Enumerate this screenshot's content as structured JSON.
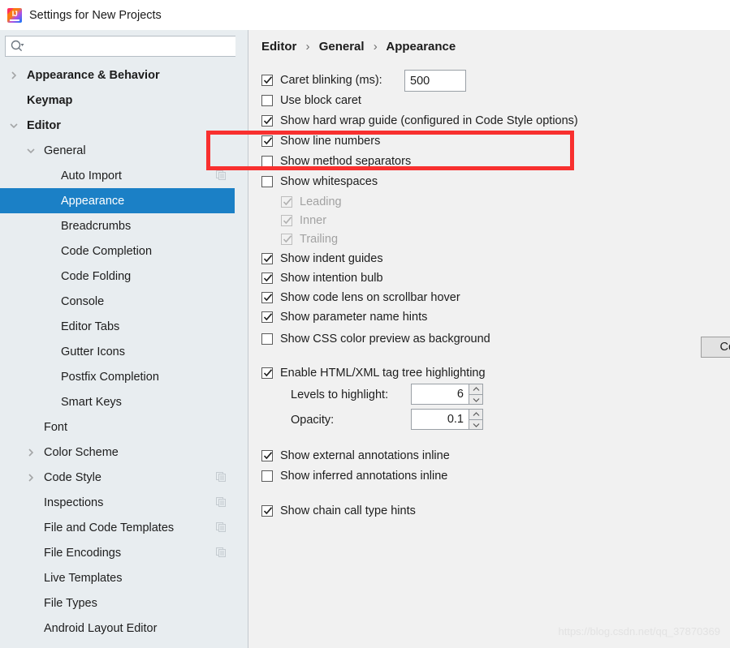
{
  "window": {
    "title": "Settings for New Projects",
    "app_icon": "intellij-idea-icon",
    "icon_text": "IJ"
  },
  "colors": {
    "selection_blue": "#1b80c6",
    "highlight_red": "#f8302f",
    "left_panel_bg": "#e8edf0",
    "right_panel_bg": "#f1f1f1",
    "scrollbar_thumb": "#c8ced4"
  },
  "search": {
    "value": "",
    "placeholder": "",
    "icon": "search-icon"
  },
  "sidebar": {
    "items": [
      {
        "label": "Appearance & Behavior",
        "level": 0,
        "arrow": "collapsed",
        "bold": true,
        "selected": false,
        "copy_icon": false
      },
      {
        "label": "Keymap",
        "level": 0,
        "arrow": "none",
        "bold": true,
        "selected": false,
        "copy_icon": false
      },
      {
        "label": "Editor",
        "level": 0,
        "arrow": "expanded",
        "bold": true,
        "selected": false,
        "copy_icon": false
      },
      {
        "label": "General",
        "level": 1,
        "arrow": "expanded",
        "bold": false,
        "selected": false,
        "copy_icon": false
      },
      {
        "label": "Auto Import",
        "level": 2,
        "arrow": "none",
        "bold": false,
        "selected": false,
        "copy_icon": true
      },
      {
        "label": "Appearance",
        "level": 2,
        "arrow": "none",
        "bold": false,
        "selected": true,
        "copy_icon": false
      },
      {
        "label": "Breadcrumbs",
        "level": 2,
        "arrow": "none",
        "bold": false,
        "selected": false,
        "copy_icon": false
      },
      {
        "label": "Code Completion",
        "level": 2,
        "arrow": "none",
        "bold": false,
        "selected": false,
        "copy_icon": false
      },
      {
        "label": "Code Folding",
        "level": 2,
        "arrow": "none",
        "bold": false,
        "selected": false,
        "copy_icon": false
      },
      {
        "label": "Console",
        "level": 2,
        "arrow": "none",
        "bold": false,
        "selected": false,
        "copy_icon": false
      },
      {
        "label": "Editor Tabs",
        "level": 2,
        "arrow": "none",
        "bold": false,
        "selected": false,
        "copy_icon": false
      },
      {
        "label": "Gutter Icons",
        "level": 2,
        "arrow": "none",
        "bold": false,
        "selected": false,
        "copy_icon": false
      },
      {
        "label": "Postfix Completion",
        "level": 2,
        "arrow": "none",
        "bold": false,
        "selected": false,
        "copy_icon": false
      },
      {
        "label": "Smart Keys",
        "level": 2,
        "arrow": "none",
        "bold": false,
        "selected": false,
        "copy_icon": false
      },
      {
        "label": "Font",
        "level": 1,
        "arrow": "none",
        "bold": false,
        "selected": false,
        "copy_icon": false
      },
      {
        "label": "Color Scheme",
        "level": 1,
        "arrow": "collapsed",
        "bold": false,
        "selected": false,
        "copy_icon": false
      },
      {
        "label": "Code Style",
        "level": 1,
        "arrow": "collapsed",
        "bold": false,
        "selected": false,
        "copy_icon": true
      },
      {
        "label": "Inspections",
        "level": 1,
        "arrow": "none",
        "bold": false,
        "selected": false,
        "copy_icon": true
      },
      {
        "label": "File and Code Templates",
        "level": 1,
        "arrow": "none",
        "bold": false,
        "selected": false,
        "copy_icon": true
      },
      {
        "label": "File Encodings",
        "level": 1,
        "arrow": "none",
        "bold": false,
        "selected": false,
        "copy_icon": true
      },
      {
        "label": "Live Templates",
        "level": 1,
        "arrow": "none",
        "bold": false,
        "selected": false,
        "copy_icon": false
      },
      {
        "label": "File Types",
        "level": 1,
        "arrow": "none",
        "bold": false,
        "selected": false,
        "copy_icon": false
      },
      {
        "label": "Android Layout Editor",
        "level": 1,
        "arrow": "none",
        "bold": false,
        "selected": false,
        "copy_icon": false
      }
    ]
  },
  "breadcrumb": {
    "part1": "Editor",
    "sep1": "›",
    "part2": "General",
    "sep2": "›",
    "part3": "Appearance"
  },
  "options": {
    "caret_blinking": {
      "label": "Caret blinking (ms):",
      "checked": true,
      "enabled": true
    },
    "caret_blinking_value": "500",
    "use_block_caret": {
      "label": "Use block caret",
      "checked": false,
      "enabled": true
    },
    "show_hard_wrap_guide": {
      "label": "Show hard wrap guide (configured in Code Style options)",
      "checked": true,
      "enabled": true
    },
    "show_line_numbers": {
      "label": "Show line numbers",
      "checked": true,
      "enabled": true
    },
    "show_method_separators": {
      "label": "Show method separators",
      "checked": false,
      "enabled": true
    },
    "show_whitespaces": {
      "label": "Show whitespaces",
      "checked": false,
      "enabled": true
    },
    "whitespace_leading": {
      "label": "Leading",
      "checked": true,
      "enabled": false
    },
    "whitespace_inner": {
      "label": "Inner",
      "checked": true,
      "enabled": false
    },
    "whitespace_trailing": {
      "label": "Trailing",
      "checked": true,
      "enabled": false
    },
    "show_indent_guides": {
      "label": "Show indent guides",
      "checked": true,
      "enabled": true
    },
    "show_intention_bulb": {
      "label": "Show intention bulb",
      "checked": true,
      "enabled": true
    },
    "show_code_lens": {
      "label": "Show code lens on scrollbar hover",
      "checked": true,
      "enabled": true
    },
    "show_parameter_name_hints": {
      "label": "Show parameter name hints",
      "checked": true,
      "enabled": true
    },
    "configure_button": "Configure...",
    "show_css_color_preview": {
      "label": "Show CSS color preview as background",
      "checked": false,
      "enabled": true
    },
    "enable_tag_tree_highlighting": {
      "label": "Enable HTML/XML tag tree highlighting",
      "checked": true,
      "enabled": true
    },
    "levels_to_highlight_label": "Levels to highlight:",
    "levels_to_highlight_value": "6",
    "opacity_label": "Opacity:",
    "opacity_value": "0.1",
    "show_external_annotations": {
      "label": "Show external annotations inline",
      "checked": true,
      "enabled": true
    },
    "show_inferred_annotations": {
      "label": "Show inferred annotations inline",
      "checked": false,
      "enabled": true
    },
    "show_chain_call_type_hints": {
      "label": "Show chain call type hints",
      "checked": true,
      "enabled": true
    }
  },
  "annotation": {
    "highlight_rect_label": "red-highlight-rectangle"
  },
  "watermark": {
    "text": "https://blog.csdn.net/qq_37870369"
  }
}
